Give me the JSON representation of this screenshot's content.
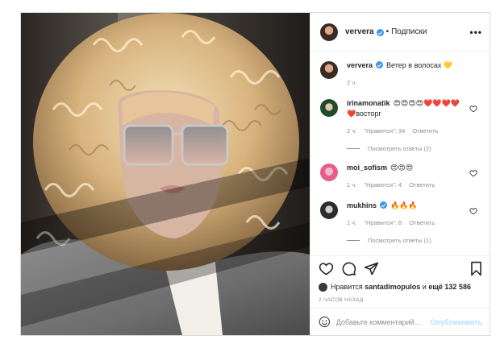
{
  "header": {
    "username": "ververa",
    "separator": "•",
    "follow_label": "Подписки",
    "more_label": "•••"
  },
  "caption": {
    "username": "ververa",
    "text": "Ветер в волосах 💛",
    "time": "2 ч."
  },
  "comments": [
    {
      "username": "irinamonatik",
      "text": "😍😍😍😍❤️❤️❤️❤️❤️восторг",
      "time": "2 ч.",
      "likes": "\"Нравится\": 34",
      "reply_label": "Ответить",
      "view_replies": "Посмотреть ответы (2)"
    },
    {
      "username": "moi_sofism",
      "text": "😍😍😍",
      "time": "1 ч.",
      "likes": "\"Нравится\": 4",
      "reply_label": "Ответить"
    },
    {
      "username": "mukhins",
      "text": "🔥🔥🔥",
      "time": "1 ч.",
      "likes": "\"Нравится\": 8",
      "reply_label": "Ответить",
      "view_replies": "Посмотреть ответы (1)"
    }
  ],
  "likes_line": {
    "prefix": "Нравится",
    "user": "santadimopulos",
    "conj": "и",
    "count": "ещё 132 586"
  },
  "timestamp": "2 ЧАСОВ НАЗАД",
  "add_comment": {
    "placeholder": "Добавьте комментарий...",
    "publish_label": "Опубликовать"
  },
  "colors": {
    "verified": "#3897f0",
    "publish_disabled": "#b2dffc",
    "secondary_text": "#8e8e8e"
  },
  "icons": [
    "heart-icon",
    "comment-icon",
    "share-icon",
    "bookmark-icon",
    "emoji-icon",
    "more-icon",
    "verified-icon"
  ]
}
